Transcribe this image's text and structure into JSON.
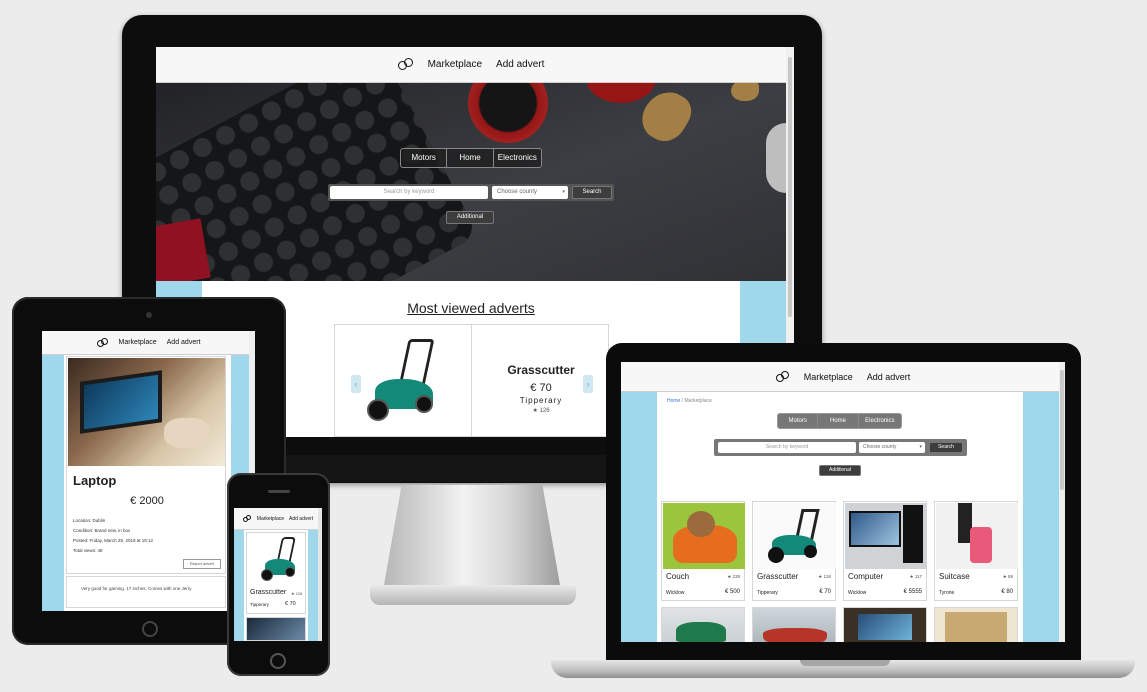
{
  "nav": {
    "marketplace": "Marketplace",
    "add_advert": "Add advert"
  },
  "categories": [
    "Motors",
    "Home",
    "Electronics"
  ],
  "search": {
    "placeholder": "Search by keyword",
    "county_select": "Choose county",
    "search_button": "Search",
    "additional_button": "Additional"
  },
  "desktop": {
    "section_title": "Most viewed adverts",
    "featured": {
      "title": "Grasscutter",
      "price": "€ 70",
      "location": "Tipperary",
      "views": "★ 126"
    }
  },
  "laptop": {
    "breadcrumb": {
      "home": "Home",
      "separator": "/",
      "current": "Marketplace"
    },
    "cards": [
      {
        "title": "Couch",
        "views": "★ 239",
        "location": "Wicklow",
        "price": "€ 500",
        "image": "couch"
      },
      {
        "title": "Grasscutter",
        "views": "★ 126",
        "location": "Tipperary",
        "price": "€ 70",
        "image": "mower"
      },
      {
        "title": "Computer",
        "views": "★ 117",
        "location": "Wicklow",
        "price": "€ 5555",
        "image": "computer"
      },
      {
        "title": "Suitcase",
        "views": "★ 88",
        "location": "Tyrone",
        "price": "€ 80",
        "image": "suitcase"
      }
    ]
  },
  "tablet": {
    "title": "Laptop",
    "price": "€ 2000",
    "details": [
      "Location: Dublin",
      "Condition: Brand new, in box",
      "Posted: Friday, March 29, 2019 at 15:12",
      "Total views: 48"
    ],
    "report_button": "Report advert",
    "footer_text": "Very good for gaming. 17 inches. Comes with one Jerry"
  },
  "phone": {
    "title": "Grasscutter",
    "views": "★ 126",
    "location": "Tipperary",
    "price": "€ 70"
  }
}
